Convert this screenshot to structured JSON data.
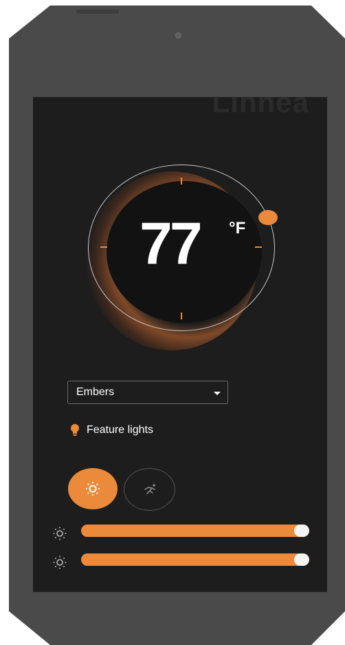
{
  "brand": {
    "text": "Linnea"
  },
  "thermostat": {
    "temperature": "77",
    "unit": "°F"
  },
  "scene_select": {
    "value": "Embers"
  },
  "feature": {
    "label": "Feature lights"
  },
  "modes": {
    "light_icon": "sun-icon",
    "motion_icon": "running-person-icon"
  },
  "sliders": [
    {
      "icon": "sun-icon",
      "level_percent": 100
    },
    {
      "icon": "sun-icon",
      "level_percent": 100
    }
  ],
  "colors": {
    "accent": "#ea8a3a",
    "screen": "#1d1d1d",
    "device": "#4a4a4a"
  }
}
